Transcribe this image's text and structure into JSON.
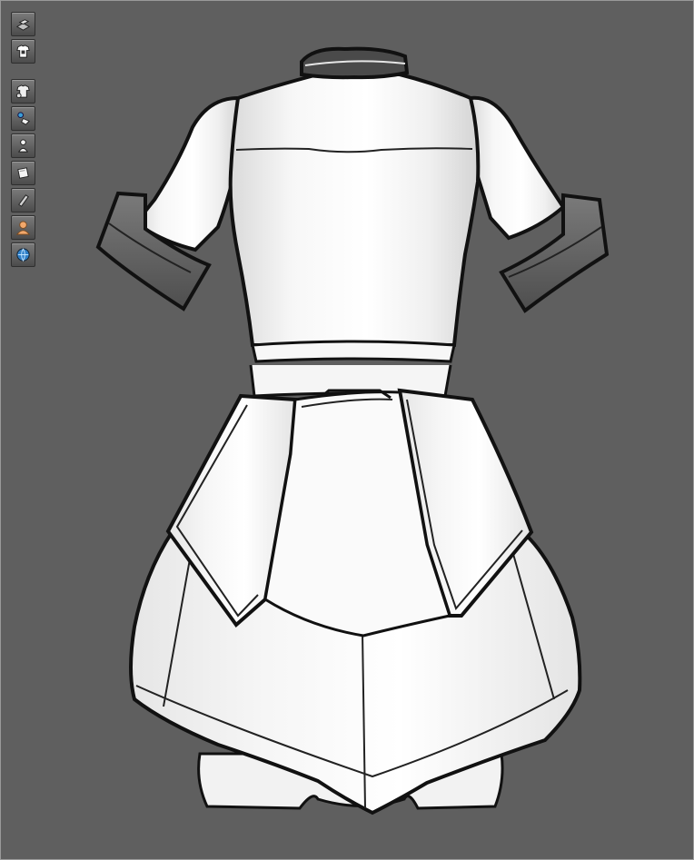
{
  "viewport": {
    "background_color": "#5f5f5f",
    "subject": "garment-back-view"
  },
  "toolbar": {
    "tools": [
      {
        "name": "fabric-box-icon"
      },
      {
        "name": "garment-tshirt-icon"
      },
      {
        "name": "show-garment-icon"
      },
      {
        "name": "show-avatar-fabric-icon"
      },
      {
        "name": "show-avatar-icon"
      },
      {
        "name": "show-pattern-icon"
      },
      {
        "name": "texture-view-icon"
      },
      {
        "name": "avatar-skin-icon"
      },
      {
        "name": "environment-globe-icon"
      }
    ]
  },
  "colors": {
    "garment_fill": "#f4f4f4",
    "garment_outline": "#111111",
    "cuff_fill": "#6a6a6a",
    "collar_fill": "#4a4a4a"
  }
}
